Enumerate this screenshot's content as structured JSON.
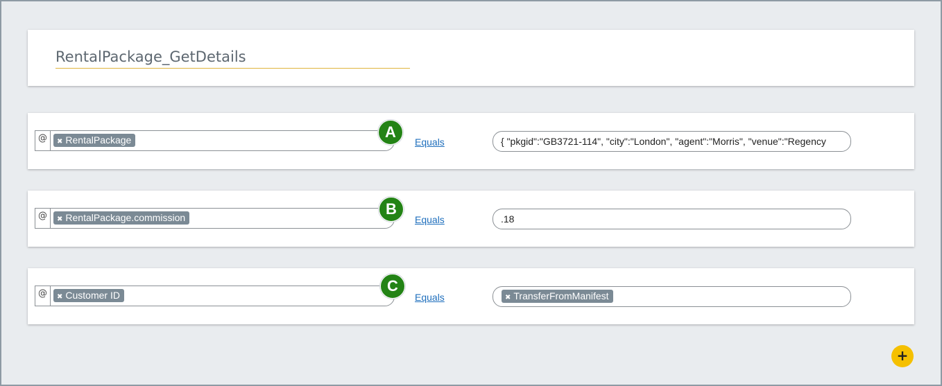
{
  "title": "RentalPackage_GetDetails",
  "conditions": [
    {
      "badge": "A",
      "at_symbol": "@",
      "lhs_token": "RentalPackage",
      "operator": "Equals",
      "rhs_text": "{ \"pkgid\":\"GB3721-114\", \"city\":\"London\", \"agent\":\"Morris\", \"venue\":\"Regency"
    },
    {
      "badge": "B",
      "at_symbol": "@",
      "lhs_token": "RentalPackage.commission",
      "operator": "Equals",
      "rhs_text": ".18"
    },
    {
      "badge": "C",
      "at_symbol": "@",
      "lhs_token": "Customer ID",
      "operator": "Equals",
      "rhs_token": "TransferFromManifest"
    }
  ],
  "remove_glyph": "✖",
  "add_button": "+",
  "colors": {
    "badge": "#238315",
    "token": "#7b8a95",
    "link": "#1f6fbd",
    "accent": "#f5c000",
    "title_underline": "#e0b43c"
  }
}
